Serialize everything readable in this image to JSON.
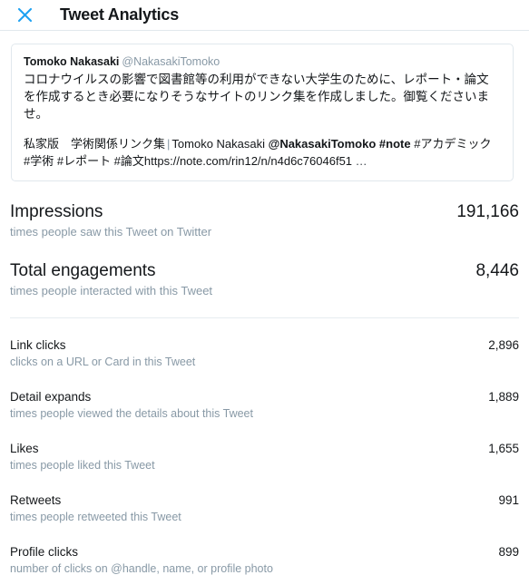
{
  "header": {
    "close_icon": "close-icon",
    "title": "Tweet Analytics"
  },
  "tweet": {
    "author_name": "Tomoko Nakasaki",
    "author_handle": "@NakasakiTomoko",
    "body": "コロナウイルスの影響で図書館等の利用ができない大学生のために、レポート・論文を作成するとき必要になりそうなサイトのリンク集を作成しました。御覧くださいませ。",
    "quoted": {
      "title": "私家版　学術関係リンク集",
      "separator": "|",
      "author_name": "Tomoko Nakasaki",
      "author_handle": "@NakasakiTomoko",
      "hashtag_note": "#note",
      "tags_rest": "#アカデミック #学術 #レポート #論文",
      "url": "https://note.com/rin12/n/n4d6c76046f51",
      "ellipsis": "…"
    }
  },
  "metrics": {
    "primary": [
      {
        "label": "Impressions",
        "description": "times people saw this Tweet on Twitter",
        "value": "191,166"
      },
      {
        "label": "Total engagements",
        "description": "times people interacted with this Tweet",
        "value": "8,446"
      }
    ],
    "secondary": [
      {
        "label": "Link clicks",
        "description": "clicks on a URL or Card in this Tweet",
        "value": "2,896"
      },
      {
        "label": "Detail expands",
        "description": "times people viewed the details about this Tweet",
        "value": "1,889"
      },
      {
        "label": "Likes",
        "description": "times people liked this Tweet",
        "value": "1,655"
      },
      {
        "label": "Retweets",
        "description": "times people retweeted this Tweet",
        "value": "991"
      },
      {
        "label": "Profile clicks",
        "description": "number of clicks on @handle, name, or profile photo",
        "value": "899"
      }
    ]
  },
  "colors": {
    "accent": "#1da1f2",
    "text": "#14171a",
    "muted": "#8899a6",
    "border": "#e1e8ed"
  }
}
